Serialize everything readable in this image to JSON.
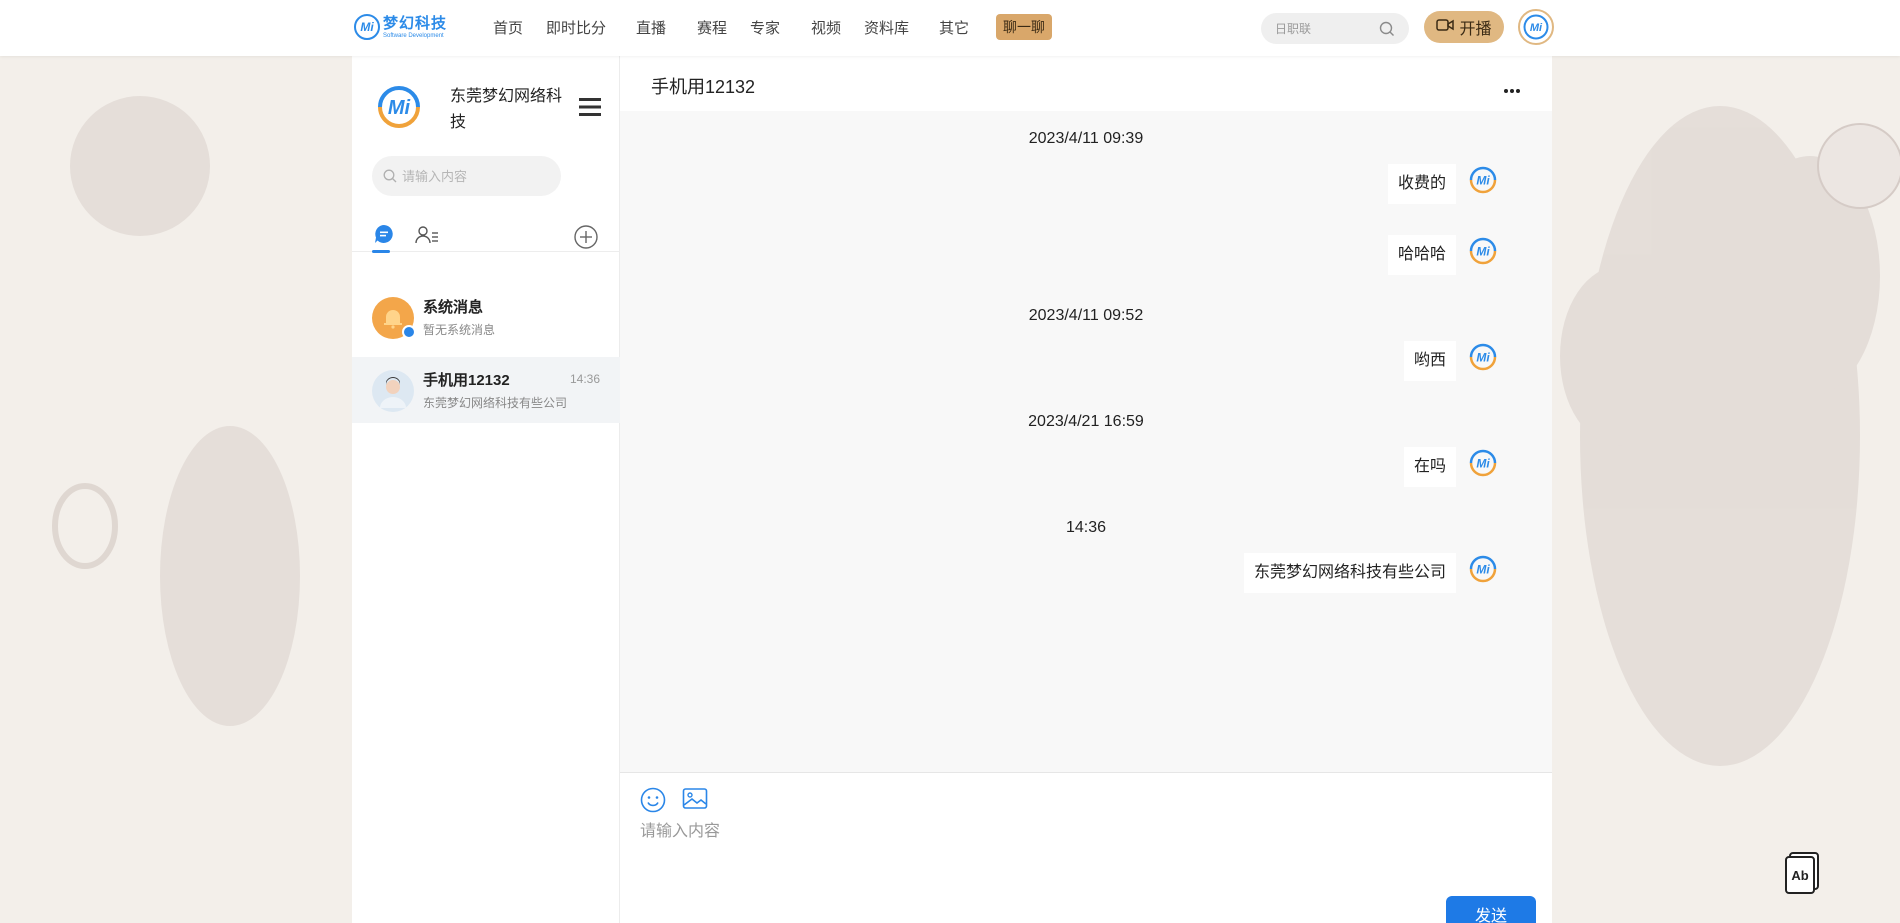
{
  "header": {
    "logo": {
      "mark": "Mi",
      "name": "梦幻科技",
      "subtitle": "Software Development"
    },
    "nav": [
      "首页",
      "即时比分",
      "直播",
      "赛程",
      "专家",
      "视频",
      "资料库",
      "其它"
    ],
    "chat_button": "聊一聊",
    "search_placeholder": "日职联",
    "live_button": "开播"
  },
  "sidebar": {
    "profile_name": "东莞梦幻网络科技",
    "search_placeholder": "请输入内容",
    "conversations": [
      {
        "title": "系统消息",
        "preview": "暂无系统消息",
        "time": ""
      },
      {
        "title": "手机用12132",
        "preview": "东莞梦幻网络科技有些公司",
        "time": "14:36"
      }
    ]
  },
  "chat": {
    "title": "手机用12132",
    "timestamps": [
      "2023/4/11 09:39",
      "2023/4/11 09:52",
      "2023/4/21 16:59",
      "14:36"
    ],
    "messages": [
      "收费的",
      "哈哈哈",
      "哟西",
      "在吗",
      "东莞梦幻网络科技有些公司"
    ],
    "input_placeholder": "请输入内容",
    "send_label": "发送"
  },
  "colors": {
    "accent_blue": "#1e7ae6",
    "gold": "#e0b882",
    "page_bg": "#f3efea"
  }
}
